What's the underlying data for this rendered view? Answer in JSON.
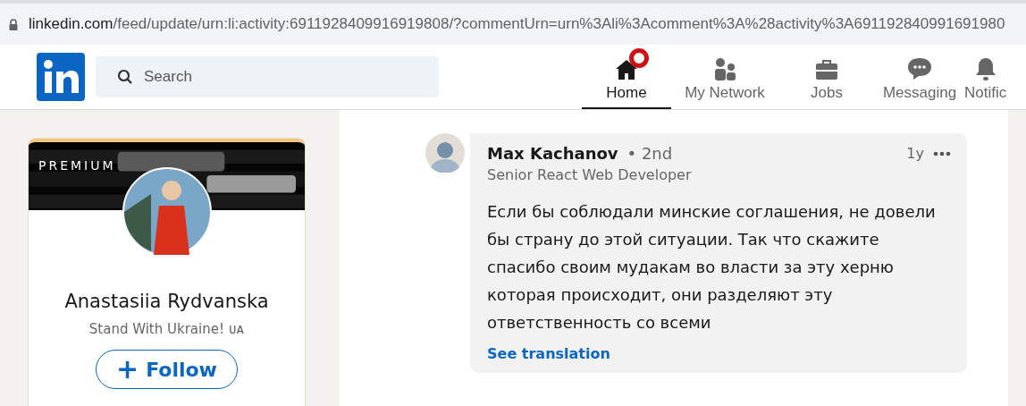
{
  "address_bar": {
    "url_host": "linkedin.com",
    "url_path": "/feed/update/urn:li:activity:6911928409916919808/?commentUrn=urn%3Ali%3Acomment%3A%28activity%3A691192840991691980"
  },
  "header": {
    "search": {
      "placeholder": "Search"
    },
    "nav": [
      {
        "kind": "home",
        "label": "Home",
        "selected": true,
        "badge": true
      },
      {
        "kind": "network",
        "label": "My Network",
        "selected": false,
        "badge": false
      },
      {
        "kind": "jobs",
        "label": "Jobs",
        "selected": false,
        "badge": false
      },
      {
        "kind": "messaging",
        "label": "Messaging",
        "selected": false,
        "badge": false
      },
      {
        "kind": "notifications",
        "label": "Notific",
        "selected": false,
        "badge": false
      }
    ]
  },
  "profile_card": {
    "premium_label": "PREMIUM",
    "name": "Anastasiia Rydvanska",
    "headline": "Stand With Ukraine! ᴜᴀ",
    "follow_button": {
      "icon": "+",
      "label": "Follow"
    }
  },
  "comment": {
    "author": "Max Kachanov",
    "degree": "• 2nd",
    "author_headline": "Senior React Web Developer",
    "time": "1y",
    "text": "Если бы соблюдали минские соглашения, не довели бы страну до этой ситуации. Так что скажите спасибо своим мудакам во власти за эту херню которая происходит, они разделяют эту ответственность со всеми",
    "translation_link": "See translation"
  }
}
